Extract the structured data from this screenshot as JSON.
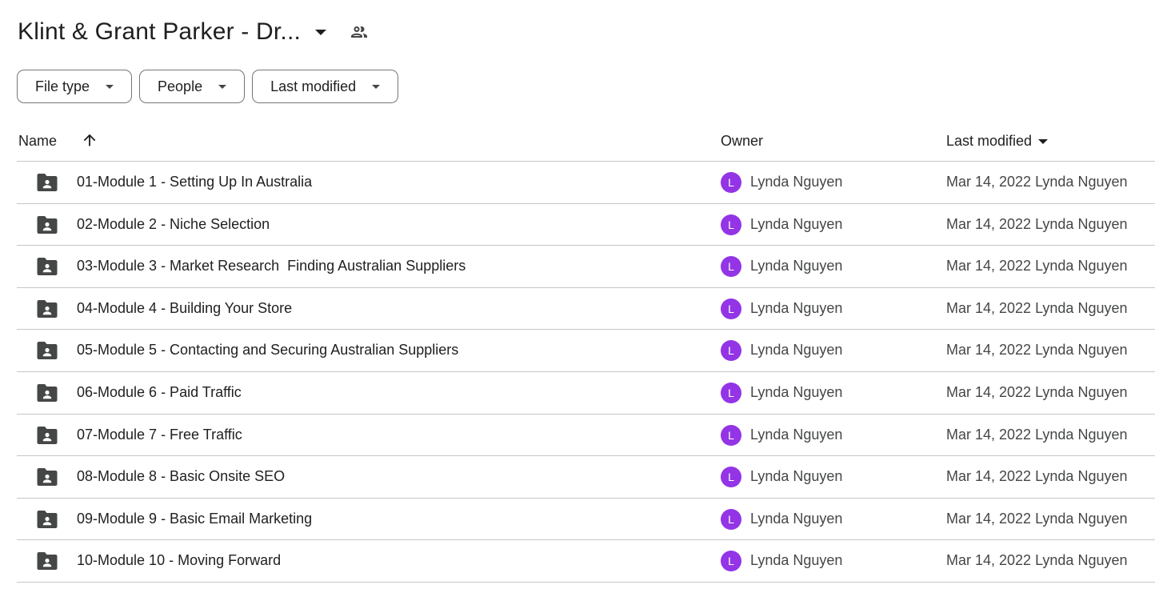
{
  "header": {
    "title": "Klint & Grant Parker - Dr...",
    "share_icon": "shared-people-icon"
  },
  "filters": [
    {
      "label": "File type"
    },
    {
      "label": "People"
    },
    {
      "label": "Last modified"
    }
  ],
  "table": {
    "columns": {
      "name": "Name",
      "sort_icon": "arrow-up-icon",
      "owner": "Owner",
      "last_modified": "Last modified"
    },
    "rows": [
      {
        "name": "01-Module 1 - Setting Up In Australia",
        "owner_initial": "L",
        "owner": "Lynda Nguyen",
        "modified": "Mar 14, 2022 Lynda Nguyen"
      },
      {
        "name": "02-Module 2 - Niche Selection",
        "owner_initial": "L",
        "owner": "Lynda Nguyen",
        "modified": "Mar 14, 2022 Lynda Nguyen"
      },
      {
        "name": "03-Module 3 - Market Research  Finding Australian Suppliers",
        "owner_initial": "L",
        "owner": "Lynda Nguyen",
        "modified": "Mar 14, 2022 Lynda Nguyen"
      },
      {
        "name": "04-Module 4 - Building Your Store",
        "owner_initial": "L",
        "owner": "Lynda Nguyen",
        "modified": "Mar 14, 2022 Lynda Nguyen"
      },
      {
        "name": "05-Module 5 - Contacting and Securing Australian Suppliers",
        "owner_initial": "L",
        "owner": "Lynda Nguyen",
        "modified": "Mar 14, 2022 Lynda Nguyen"
      },
      {
        "name": "06-Module 6 - Paid Traffic",
        "owner_initial": "L",
        "owner": "Lynda Nguyen",
        "modified": "Mar 14, 2022 Lynda Nguyen"
      },
      {
        "name": "07-Module 7 - Free Traffic",
        "owner_initial": "L",
        "owner": "Lynda Nguyen",
        "modified": "Mar 14, 2022 Lynda Nguyen"
      },
      {
        "name": "08-Module 8 - Basic Onsite SEO",
        "owner_initial": "L",
        "owner": "Lynda Nguyen",
        "modified": "Mar 14, 2022 Lynda Nguyen"
      },
      {
        "name": "09-Module 9 - Basic Email Marketing",
        "owner_initial": "L",
        "owner": "Lynda Nguyen",
        "modified": "Mar 14, 2022 Lynda Nguyen"
      },
      {
        "name": "10-Module 10 - Moving Forward",
        "owner_initial": "L",
        "owner": "Lynda Nguyen",
        "modified": "Mar 14, 2022 Lynda Nguyen"
      }
    ]
  },
  "colors": {
    "avatar": "#9334e6",
    "folder": "#444746",
    "divider": "#c4c7c5"
  }
}
